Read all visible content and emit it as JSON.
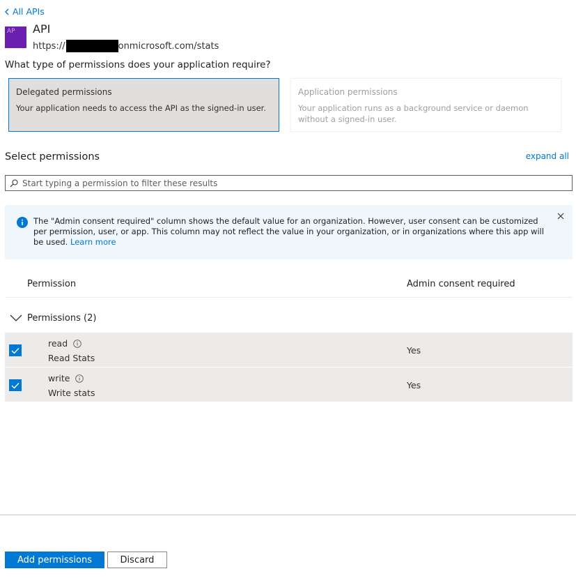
{
  "nav": {
    "back_label": "All APIs",
    "back_icon": "chevron-left-icon"
  },
  "api": {
    "avatar_text": "AP",
    "name": "API",
    "url_prefix": "https://",
    "url_suffix": "onmicrosoft.com/stats"
  },
  "question": "What type of permissions does your application require?",
  "permission_types": [
    {
      "title": "Delegated permissions",
      "description": "Your application needs to access the API as the signed-in user.",
      "selected": true
    },
    {
      "title": "Application permissions",
      "description": "Your application runs as a background service or daemon without a signed-in user.",
      "selected": false
    }
  ],
  "select_permissions": {
    "heading": "Select permissions",
    "expand_all": "expand all",
    "filter_placeholder": "Start typing a permission to filter these results"
  },
  "info_bar": {
    "message": "The \"Admin consent required\" column shows the default value for an organization. However, user consent can be customized per permission, user, or app. This column may not reflect the value in your organization, or in organizations where this app will be used.",
    "link_text": "Learn more"
  },
  "table": {
    "columns": [
      "Permission",
      "Admin consent required"
    ],
    "group_label": "Permissions (2)",
    "rows": [
      {
        "name": "read",
        "description": "Read Stats",
        "admin_consent": "Yes",
        "checked": true
      },
      {
        "name": "write",
        "description": "Write stats",
        "admin_consent": "Yes",
        "checked": true
      }
    ]
  },
  "footer": {
    "primary_label": "Add permissions",
    "secondary_label": "Discard"
  },
  "colors": {
    "accent": "#0078d4",
    "selected_bg": "#e1dfdd",
    "info_bg": "#eff6fc",
    "avatar": "#6a1fae"
  }
}
